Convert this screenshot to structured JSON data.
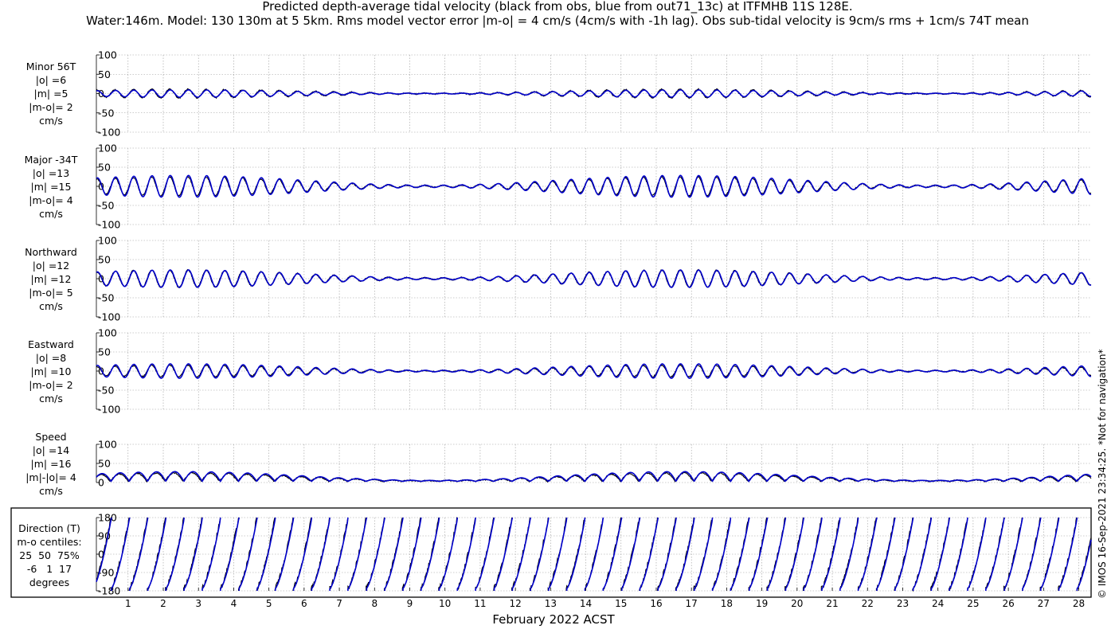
{
  "title_line1": "Predicted depth-average tidal velocity (black from obs, blue from out71_13c) at ITFMHB 11S 128E.",
  "title_line2": "Water:146m. Model: 130 130m at 5 5km. Rms model vector error |m-o| = 4 cm/s (4cm/s with -1h lag). Obs sub-tidal velocity is 9cm/s rms + 1cm/s 74T mean",
  "xlabel": "February 2022 ACST",
  "credit": "© IMOS 16-Sep-2021 23:34:25. *Not for navigation*",
  "colors": {
    "obs": "#000000",
    "model": "#0000cc",
    "grid": "#9a9a9a"
  },
  "chart_data": [
    {
      "type": "line",
      "panel": "minor",
      "label": "Minor 56T\n|o| =6\n|m| =5\n|m-o|= 2\ncm/s",
      "ylim": [
        -100,
        100
      ],
      "yticks": [
        100,
        50,
        0,
        -50,
        -100
      ],
      "obs_amp": 6,
      "model_amp": 5
    },
    {
      "type": "line",
      "panel": "major",
      "label": "Major -34T\n|o| =13\n|m| =15\n|m-o|= 4\ncm/s",
      "ylim": [
        -100,
        100
      ],
      "yticks": [
        100,
        50,
        0,
        -50,
        -100
      ],
      "obs_amp": 13,
      "model_amp": 15
    },
    {
      "type": "line",
      "panel": "north",
      "label": "Northward\n|o| =12\n|m| =12\n|m-o|= 5\ncm/s",
      "ylim": [
        -100,
        100
      ],
      "yticks": [
        100,
        50,
        0,
        -50,
        -100
      ],
      "obs_amp": 12,
      "model_amp": 12
    },
    {
      "type": "line",
      "panel": "east",
      "label": "Eastward\n|o| =8\n|m| =10\n|m-o|= 2\ncm/s",
      "ylim": [
        -100,
        100
      ],
      "yticks": [
        100,
        50,
        0,
        -50,
        -100
      ],
      "obs_amp": 8,
      "model_amp": 10
    },
    {
      "type": "line",
      "panel": "speed",
      "label": "Speed\n|o| =14\n|m| =16\n|m|-|o|= 4\ncm/s",
      "ylim": [
        0,
        100
      ],
      "yticks": [
        100,
        50,
        0
      ],
      "obs_amp": 14,
      "model_amp": 16
    },
    {
      "type": "line",
      "panel": "direction",
      "label": "Direction (T)\nm-o centiles:\n25  50  75%\n-6   1  17\ndegrees",
      "ylim": [
        -180,
        180
      ],
      "yticks": [
        180,
        90,
        0,
        -90,
        -180
      ]
    }
  ],
  "x_axis": {
    "days": [
      "1",
      "2",
      "3",
      "4",
      "5",
      "6",
      "7",
      "8",
      "9",
      "10",
      "11",
      "12",
      "13",
      "14",
      "15",
      "16",
      "17",
      "18",
      "19",
      "20",
      "21",
      "22",
      "23",
      "24",
      "25",
      "26",
      "27",
      "28"
    ]
  }
}
